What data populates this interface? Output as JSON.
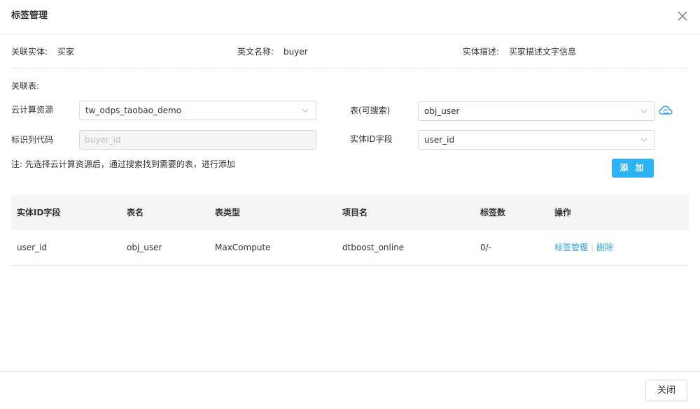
{
  "dialog": {
    "title": "标签管理"
  },
  "entity_info": {
    "entity_label": "关联实体:",
    "entity_value": "买家",
    "english_label": "英文名称:",
    "english_value": "buyer",
    "desc_label": "实体描述:",
    "desc_value": "买家描述文字信息"
  },
  "form": {
    "section_label": "关联表:",
    "cloud_resource_label": "云计算资源",
    "cloud_resource_value": "tw_odps_taobao_demo",
    "table_label": "表(可搜索)",
    "table_value": "obj_user",
    "id_code_label": "标识列代码",
    "id_code_placeholder": "buyer_id",
    "entity_id_field_label": "实体ID字段",
    "entity_id_field_value": "user_id",
    "note": "注: 先选择云计算资源后，通过搜索找到需要的表，进行添加",
    "add_label": "添 加"
  },
  "table": {
    "columns": [
      "实体ID字段",
      "表名",
      "表类型",
      "项目名",
      "标签数",
      "操作"
    ],
    "rows": [
      {
        "entity_id_field": "user_id",
        "table_name": "obj_user",
        "table_type": "MaxCompute",
        "project": "dtboost_online",
        "tag_count": "0/-",
        "op_manage": "标签管理",
        "op_delete": "删除"
      }
    ]
  },
  "footer": {
    "close_label": "关闭"
  },
  "colors": {
    "accent": "#2cb3f5",
    "link": "#2b9fe0"
  },
  "icons": {
    "close": "close-icon",
    "chevron": "chevron-down-icon",
    "cloud": "cloud-sync-icon"
  }
}
